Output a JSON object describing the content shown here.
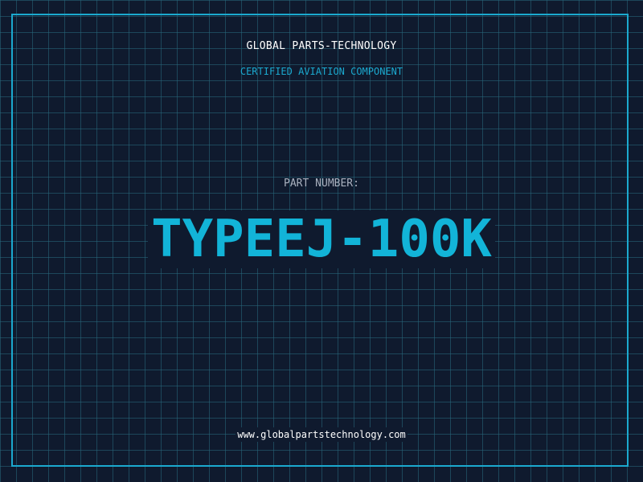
{
  "header": {
    "company": "GLOBAL PARTS-TECHNOLOGY",
    "subtitle": "CERTIFIED AVIATION COMPONENT"
  },
  "part": {
    "label": "PART NUMBER:",
    "number": "TYPEEJ-100K"
  },
  "footer": {
    "website": "www.globalpartstechnology.com"
  },
  "colors": {
    "background": "#0f1a2e",
    "grid": "#28697d",
    "accent": "#1ba9cf",
    "part_number": "#12b4d8",
    "label": "#aab2c0",
    "text": "#ffffff"
  }
}
